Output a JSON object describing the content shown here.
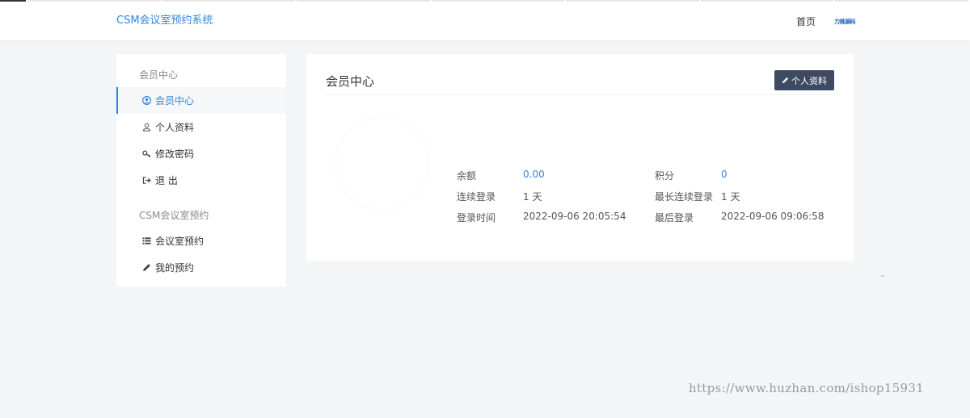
{
  "header": {
    "brand": "CSM会议室预约系统",
    "nav_home": "首页",
    "logo_text": "力推源码"
  },
  "sidebar": {
    "section1_heading": "会员中心",
    "items1": [
      {
        "label": "会员中心",
        "icon": "user-circle-icon",
        "active": true
      },
      {
        "label": "个人资料",
        "icon": "user-icon",
        "active": false
      },
      {
        "label": "修改密码",
        "icon": "key-icon",
        "active": false
      },
      {
        "label": "退 出",
        "icon": "sign-out-icon",
        "active": false
      }
    ],
    "section2_heading": "CSM会议室预约",
    "items2": [
      {
        "label": "会议室预约",
        "icon": "list-icon",
        "active": false
      },
      {
        "label": "我的预约",
        "icon": "pencil-icon",
        "active": false
      }
    ]
  },
  "main": {
    "title": "会员中心",
    "profile_button": "个人资料",
    "stats": {
      "balance_label": "余额",
      "balance_value": "0.00",
      "points_label": "积分",
      "points_value": "0",
      "streak_label": "连续登录",
      "streak_value": "1 天",
      "max_streak_label": "最长连续登录",
      "max_streak_value": "1 天",
      "login_time_label": "登录时间",
      "login_time_value": "2022-09-06 20:05:54",
      "last_login_label": "最后登录",
      "last_login_value": "2022-09-06 09:06:58"
    }
  },
  "watermark": "https://www.huzhan.com/ishop15931",
  "colors": {
    "accent": "#2f86e0",
    "button_bg": "#3e4a63",
    "page_bg": "#f4f5f7"
  }
}
